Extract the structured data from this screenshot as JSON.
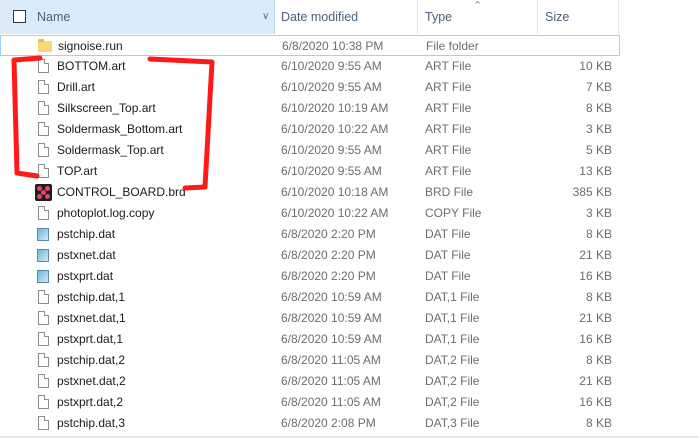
{
  "header": {
    "name_label": "Name",
    "date_label": "Date modified",
    "type_label": "Type",
    "size_label": "Size"
  },
  "files": [
    {
      "icon": "folder-icon",
      "name": "signoise.run",
      "date": "6/8/2020 10:38 PM",
      "type": "File folder",
      "size": "",
      "selected": true
    },
    {
      "icon": "file-icon",
      "name": "BOTTOM.art",
      "date": "6/10/2020 9:55 AM",
      "type": "ART File",
      "size": "10 KB"
    },
    {
      "icon": "file-icon",
      "name": "Drill.art",
      "date": "6/10/2020 9:55 AM",
      "type": "ART File",
      "size": "7 KB"
    },
    {
      "icon": "file-icon",
      "name": "Silkscreen_Top.art",
      "date": "6/10/2020 10:19 AM",
      "type": "ART File",
      "size": "8 KB"
    },
    {
      "icon": "file-icon",
      "name": "Soldermask_Bottom.art",
      "date": "6/10/2020 10:22 AM",
      "type": "ART File",
      "size": "3 KB"
    },
    {
      "icon": "file-icon",
      "name": "Soldermask_Top.art",
      "date": "6/10/2020 9:55 AM",
      "type": "ART File",
      "size": "5 KB"
    },
    {
      "icon": "file-icon",
      "name": "TOP.art",
      "date": "6/10/2020 9:55 AM",
      "type": "ART File",
      "size": "13 KB"
    },
    {
      "icon": "brd-file-icon",
      "name": "CONTROL_BOARD.brd",
      "date": "6/10/2020 10:18 AM",
      "type": "BRD File",
      "size": "385 KB"
    },
    {
      "icon": "file-icon",
      "name": "photoplot.log.copy",
      "date": "6/10/2020 10:22 AM",
      "type": "COPY File",
      "size": "3 KB"
    },
    {
      "icon": "dat-file-icon",
      "name": "pstchip.dat",
      "date": "6/8/2020 2:20 PM",
      "type": "DAT File",
      "size": "8 KB"
    },
    {
      "icon": "dat-file-icon",
      "name": "pstxnet.dat",
      "date": "6/8/2020 2:20 PM",
      "type": "DAT File",
      "size": "21 KB"
    },
    {
      "icon": "dat-file-icon",
      "name": "pstxprt.dat",
      "date": "6/8/2020 2:20 PM",
      "type": "DAT File",
      "size": "16 KB"
    },
    {
      "icon": "file-icon",
      "name": "pstchip.dat,1",
      "date": "6/8/2020 10:59 AM",
      "type": "DAT,1 File",
      "size": "8 KB"
    },
    {
      "icon": "file-icon",
      "name": "pstxnet.dat,1",
      "date": "6/8/2020 10:59 AM",
      "type": "DAT,1 File",
      "size": "21 KB"
    },
    {
      "icon": "file-icon",
      "name": "pstxprt.dat,1",
      "date": "6/8/2020 10:59 AM",
      "type": "DAT,1 File",
      "size": "16 KB"
    },
    {
      "icon": "file-icon",
      "name": "pstchip.dat,2",
      "date": "6/8/2020 11:05 AM",
      "type": "DAT,2 File",
      "size": "8 KB"
    },
    {
      "icon": "file-icon",
      "name": "pstxnet.dat,2",
      "date": "6/8/2020 11:05 AM",
      "type": "DAT,2 File",
      "size": "21 KB"
    },
    {
      "icon": "file-icon",
      "name": "pstxprt.dat,2",
      "date": "6/8/2020 11:05 AM",
      "type": "DAT,2 File",
      "size": "16 KB"
    },
    {
      "icon": "file-icon",
      "name": "pstchip.dat,3",
      "date": "6/8/2020 2:08 PM",
      "type": "DAT,3 File",
      "size": "8 KB"
    }
  ],
  "colors": {
    "header_active_bg": "#d9ebf9",
    "header_text": "#4c607a",
    "annotation_red": "#ff1a1a",
    "selection_border": "#99d1ff"
  }
}
